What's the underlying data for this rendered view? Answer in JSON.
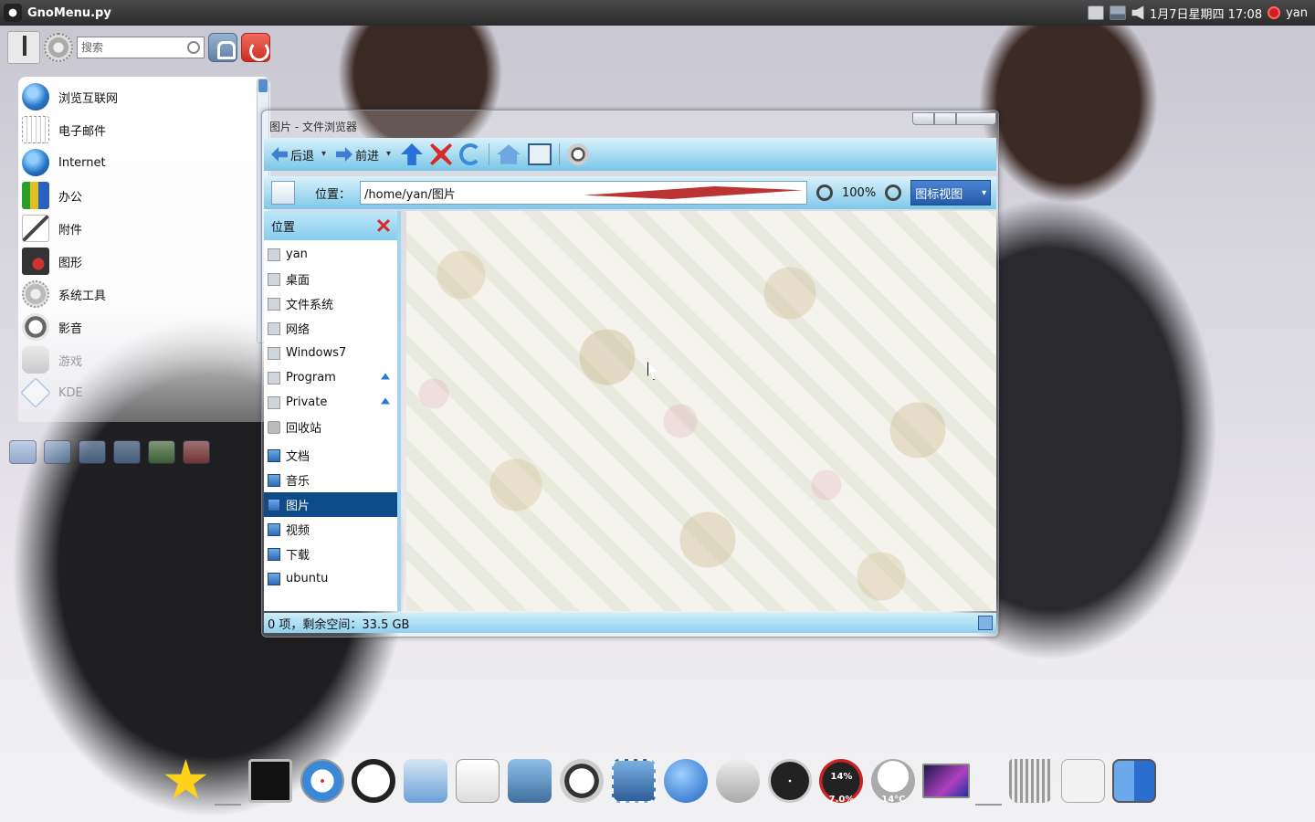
{
  "top_panel": {
    "app_title": "GnoMenu.py",
    "datetime": "1月7日星期四 17:08",
    "user": "yan"
  },
  "gnomenu": {
    "search": {
      "placeholder": "搜索",
      "value": ""
    },
    "items": [
      {
        "label": "浏览互联网",
        "icon": "web-browser-icon"
      },
      {
        "label": "电子邮件",
        "icon": "mail-icon"
      },
      {
        "label": "Internet",
        "icon": "internet-globe-icon"
      },
      {
        "label": "办公",
        "icon": "office-icon"
      },
      {
        "label": "附件",
        "icon": "accessories-icon"
      },
      {
        "label": "图形",
        "icon": "graphics-icon"
      },
      {
        "label": "系统工具",
        "icon": "system-tools-icon"
      },
      {
        "label": "影音",
        "icon": "multimedia-icon"
      },
      {
        "label": "游戏",
        "icon": "games-icon"
      },
      {
        "label": "KDE",
        "icon": "kde-icon"
      }
    ]
  },
  "file_browser": {
    "title": "图片 - 文件浏览器",
    "toolbar": {
      "back_label": "后退",
      "forward_label": "前进"
    },
    "location": {
      "label": "位置：",
      "path": "/home/yan/图片",
      "zoom": "100%",
      "view_mode": "图标视图"
    },
    "sidebar": {
      "header": "位置",
      "places": [
        {
          "label": "yan",
          "icon": "home-folder-icon"
        },
        {
          "label": "桌面",
          "icon": "desktop-icon"
        },
        {
          "label": "文件系统",
          "icon": "filesystem-icon"
        },
        {
          "label": "网络",
          "icon": "network-icon"
        },
        {
          "label": "Windows7",
          "icon": "drive-icon"
        },
        {
          "label": "Program",
          "icon": "drive-icon",
          "eject": true
        },
        {
          "label": "Private",
          "icon": "drive-icon",
          "eject": true
        },
        {
          "label": "回收站",
          "icon": "trash-icon"
        }
      ],
      "bookmarks": [
        {
          "label": "文档",
          "icon": "documents-folder-icon"
        },
        {
          "label": "音乐",
          "icon": "music-folder-icon"
        },
        {
          "label": "图片",
          "icon": "pictures-folder-icon",
          "selected": true
        },
        {
          "label": "视频",
          "icon": "videos-folder-icon"
        },
        {
          "label": "下载",
          "icon": "downloads-folder-icon"
        },
        {
          "label": "ubuntu",
          "icon": "folder-icon"
        }
      ]
    },
    "status": "0 项，剩余空间：33.5 GB"
  },
  "dock": {
    "cpu_top": "14%",
    "cpu_bottom": "7.0%",
    "weather_temp": "14°C"
  }
}
